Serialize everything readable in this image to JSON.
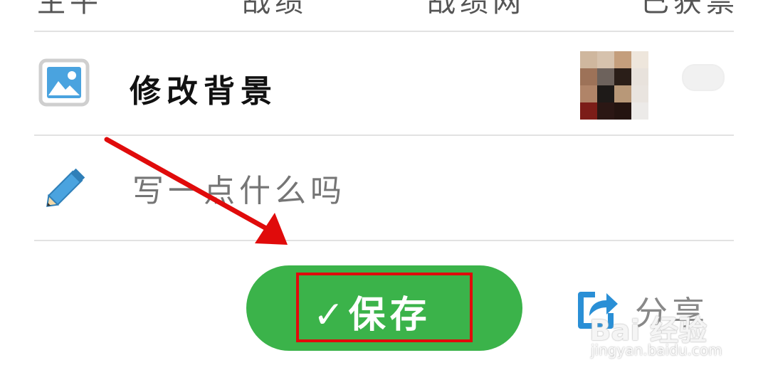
{
  "top_tabs": [
    "生平",
    "战绩",
    "战绩网",
    "已获票"
  ],
  "background_row": {
    "label": "修改背景",
    "thumbnail_colors": [
      [
        "#cfb79e",
        "#d6c2ad",
        "#c49e7c",
        "#eee6dc"
      ],
      [
        "#9d7258",
        "#6d625c",
        "#2a1e18",
        "#e8e2dc"
      ],
      [
        "#b08468",
        "#1e1a18",
        "#b89878",
        "#e9e4df"
      ],
      [
        "#7c1d18",
        "#2b1714",
        "#241410",
        "#eceae8"
      ]
    ]
  },
  "note_input": {
    "placeholder": "写一点什么吗"
  },
  "actions": {
    "save_label": "✓保存",
    "share_label": "分享"
  },
  "colors": {
    "save_green": "#3bb34a",
    "highlight_red": "#e00b0b",
    "icon_blue": "#4aa3df"
  },
  "watermark": {
    "brand": "Bai 经验",
    "url": "jingyan.baidu.com"
  }
}
